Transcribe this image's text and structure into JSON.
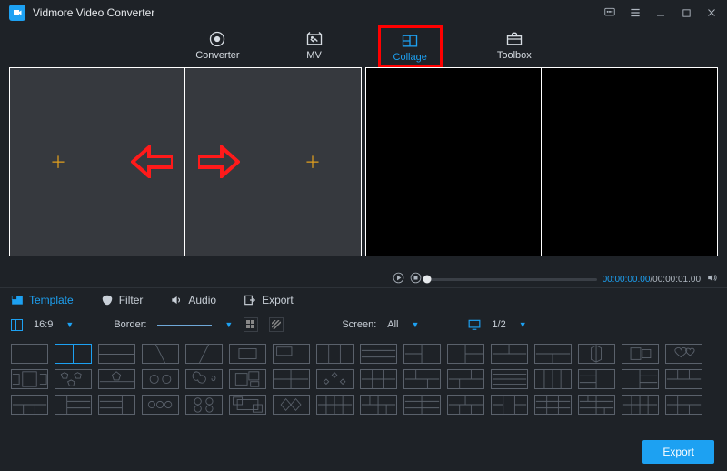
{
  "app": {
    "title": "Vidmore Video Converter"
  },
  "nav": {
    "converter": "Converter",
    "mv": "MV",
    "collage": "Collage",
    "toolbox": "Toolbox",
    "active": "collage"
  },
  "tabs": {
    "template": "Template",
    "filter": "Filter",
    "audio": "Audio",
    "export": "Export",
    "active": "template"
  },
  "options": {
    "ratio": "16:9",
    "border_label": "Border:",
    "screen_label": "Screen:",
    "screen_value": "All",
    "page": "1/2"
  },
  "player": {
    "current": "00:00:00.00",
    "total": "00:00:01.00",
    "separator": "/"
  },
  "export_button": "Export",
  "icons": {
    "chat": "chat",
    "menu": "menu",
    "min": "min",
    "max": "max",
    "close": "close"
  }
}
